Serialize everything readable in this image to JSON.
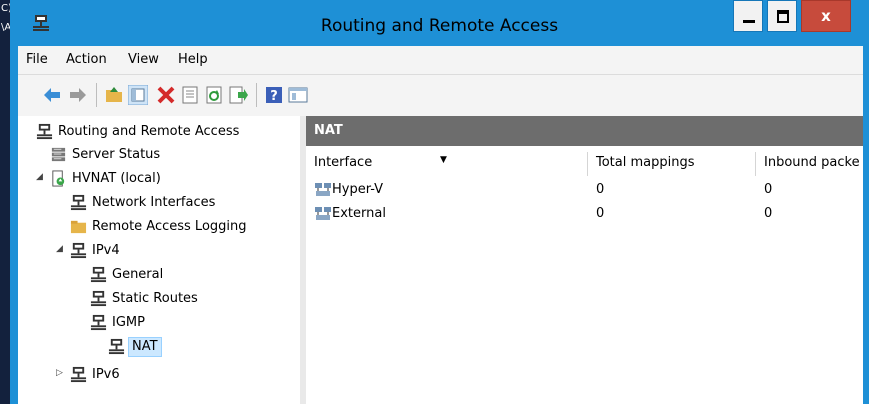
{
  "window": {
    "title": "Routing and Remote Access"
  },
  "menu": [
    {
      "label": "File"
    },
    {
      "label": "Action"
    },
    {
      "label": "View"
    },
    {
      "label": "Help"
    }
  ],
  "toolbar_icons": [
    "back-arrow-icon",
    "forward-arrow-icon",
    "up-folder-icon",
    "show-hide-tree-icon",
    "delete-icon",
    "properties-icon",
    "refresh-icon",
    "export-list-icon",
    "help-icon",
    "show-console-tree-icon"
  ],
  "tree": {
    "root": "Routing and Remote Access",
    "server_status": "Server Status",
    "server": "HVNAT (local)",
    "network_interfaces": "Network Interfaces",
    "remote_access_logging": "Remote Access Logging",
    "ipv4": "IPv4",
    "general": "General",
    "static_routes": "Static Routes",
    "igmp": "IGMP",
    "nat": "NAT",
    "ipv6": "IPv6"
  },
  "right_pane": {
    "title": "NAT",
    "columns": [
      "Interface",
      "Total mappings",
      "Inbound packe"
    ],
    "rows": [
      {
        "interface": "Hyper-V",
        "total_mappings": "0",
        "inbound_packets": "0"
      },
      {
        "interface": "External",
        "total_mappings": "0",
        "inbound_packets": "0"
      }
    ]
  },
  "colors": {
    "titlebar": "#1e90d6",
    "close_button": "#c74b3c",
    "pane_header": "#6d6d6d",
    "selection": "#cce8ff"
  }
}
